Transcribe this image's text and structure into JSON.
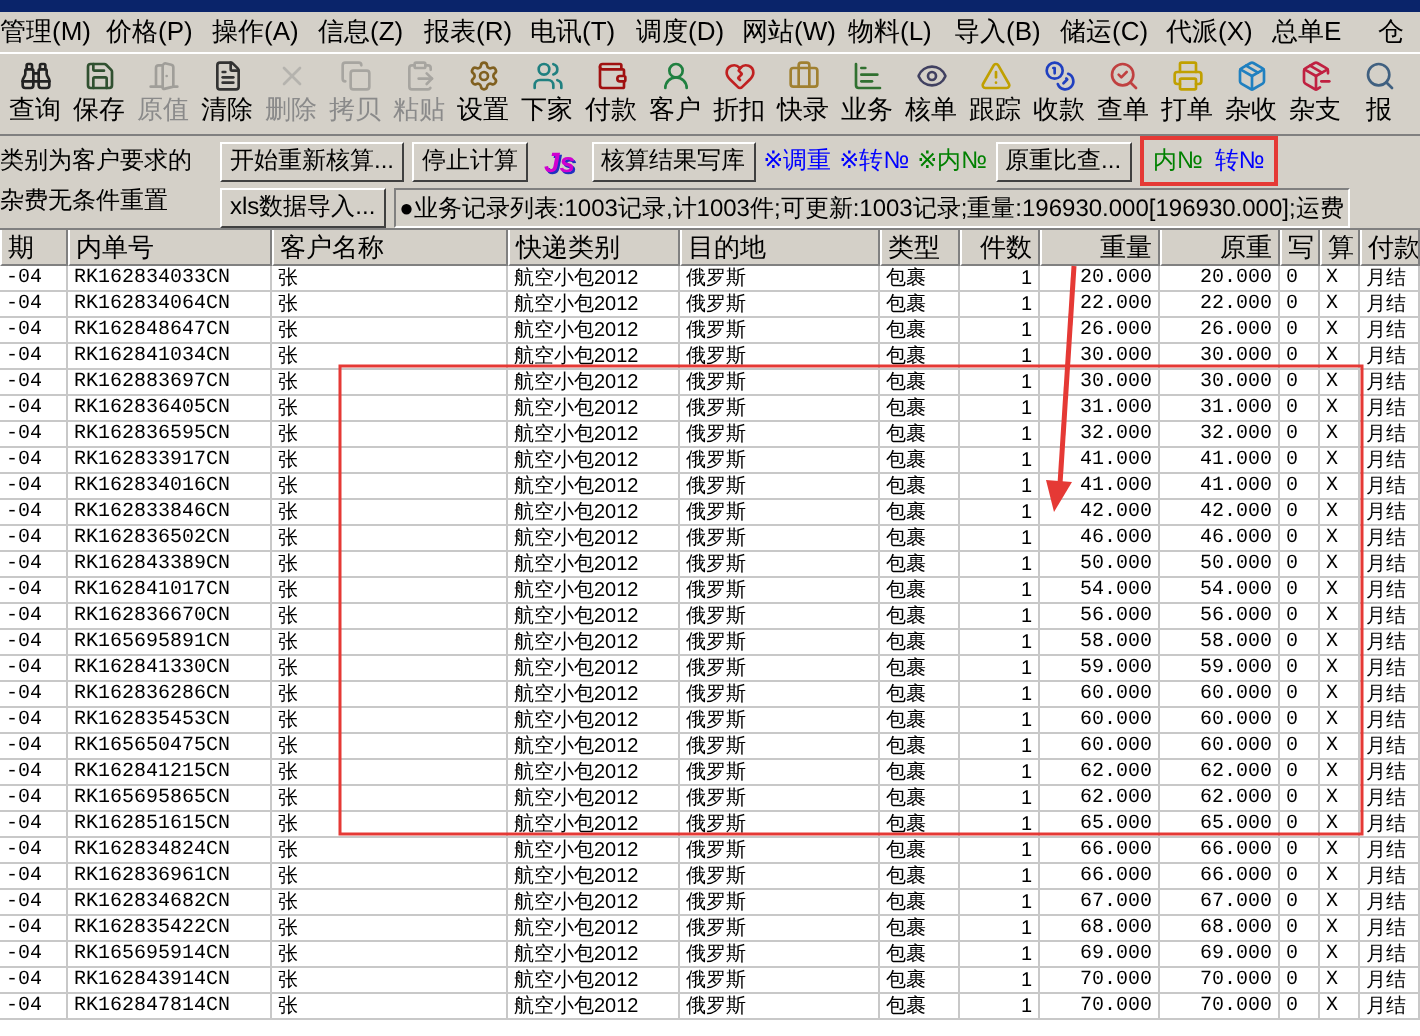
{
  "menu": [
    "管理(M)",
    "价格(P)",
    "操作(A)",
    "信息(Z)",
    "报表(R)",
    "电讯(T)",
    "调度(D)",
    "网站(W)",
    "物料(L)",
    "导入(B)",
    "储运(C)",
    "代派(X)",
    "总单E",
    "仓"
  ],
  "toolbar": [
    {
      "label": "查询",
      "disabled": false
    },
    {
      "label": "保存",
      "disabled": false
    },
    {
      "label": "原值",
      "disabled": true
    },
    {
      "label": "清除",
      "disabled": false
    },
    {
      "label": "删除",
      "disabled": true
    },
    {
      "label": "拷贝",
      "disabled": true
    },
    {
      "label": "粘贴",
      "disabled": true
    },
    {
      "label": "设置",
      "disabled": false
    },
    {
      "label": "下家",
      "disabled": false
    },
    {
      "label": "付款",
      "disabled": false
    },
    {
      "label": "客户",
      "disabled": false
    },
    {
      "label": "折扣",
      "disabled": false
    },
    {
      "label": "快录",
      "disabled": false
    },
    {
      "label": "业务",
      "disabled": false
    },
    {
      "label": "核单",
      "disabled": false
    },
    {
      "label": "跟踪",
      "disabled": false
    },
    {
      "label": "收款",
      "disabled": false
    },
    {
      "label": "查单",
      "disabled": false
    },
    {
      "label": "打单",
      "disabled": false
    },
    {
      "label": "杂收",
      "disabled": false
    },
    {
      "label": "杂支",
      "disabled": false
    },
    {
      "label": "报",
      "disabled": false
    }
  ],
  "options_note": [
    "类别为客户要求的",
    "杂费无条件重置"
  ],
  "buttons_row1": [
    "开始重新核算...",
    "停止计算"
  ],
  "js_badge": "Js",
  "write_button": "核算结果写库",
  "links": [
    {
      "label": "※调重",
      "color": "#0000ff"
    },
    {
      "label": "※转№",
      "color": "#0000ff"
    },
    {
      "label": "※内№",
      "color": "#008000"
    }
  ],
  "compare_button": "原重比查...",
  "highlight_links": [
    {
      "label": "内№",
      "color": "#008000"
    },
    {
      "label": "转№",
      "color": "#0000ff"
    }
  ],
  "import_button": "xls数据导入...",
  "status": "●业务记录列表:1003记录,计1003件;可更新:1003记录;重量:196930.000[196930.000];运费",
  "table": {
    "columns": [
      "期",
      "内单号",
      "客户名称",
      "快递类别",
      "目的地",
      "类型",
      "件数",
      "重量",
      "原重",
      "写",
      "算",
      "付款"
    ],
    "rows": [
      [
        "-04",
        "RK162834033CN",
        "张",
        "航空小包2012",
        "俄罗斯",
        "包裹",
        "1",
        "20.000",
        "20.000",
        "0",
        "X",
        "月结"
      ],
      [
        "-04",
        "RK162834064CN",
        "张",
        "航空小包2012",
        "俄罗斯",
        "包裹",
        "1",
        "22.000",
        "22.000",
        "0",
        "X",
        "月结"
      ],
      [
        "-04",
        "RK162848647CN",
        "张",
        "航空小包2012",
        "俄罗斯",
        "包裹",
        "1",
        "26.000",
        "26.000",
        "0",
        "X",
        "月结"
      ],
      [
        "-04",
        "RK162841034CN",
        "张",
        "航空小包2012",
        "俄罗斯",
        "包裹",
        "1",
        "30.000",
        "30.000",
        "0",
        "X",
        "月结"
      ],
      [
        "-04",
        "RK162883697CN",
        "张",
        "航空小包2012",
        "俄罗斯",
        "包裹",
        "1",
        "30.000",
        "30.000",
        "0",
        "X",
        "月结"
      ],
      [
        "-04",
        "RK162836405CN",
        "张",
        "航空小包2012",
        "俄罗斯",
        "包裹",
        "1",
        "31.000",
        "31.000",
        "0",
        "X",
        "月结"
      ],
      [
        "-04",
        "RK162836595CN",
        "张",
        "航空小包2012",
        "俄罗斯",
        "包裹",
        "1",
        "32.000",
        "32.000",
        "0",
        "X",
        "月结"
      ],
      [
        "-04",
        "RK162833917CN",
        "张",
        "航空小包2012",
        "俄罗斯",
        "包裹",
        "1",
        "41.000",
        "41.000",
        "0",
        "X",
        "月结"
      ],
      [
        "-04",
        "RK162834016CN",
        "张",
        "航空小包2012",
        "俄罗斯",
        "包裹",
        "1",
        "41.000",
        "41.000",
        "0",
        "X",
        "月结"
      ],
      [
        "-04",
        "RK162833846CN",
        "张",
        "航空小包2012",
        "俄罗斯",
        "包裹",
        "1",
        "42.000",
        "42.000",
        "0",
        "X",
        "月结"
      ],
      [
        "-04",
        "RK162836502CN",
        "张",
        "航空小包2012",
        "俄罗斯",
        "包裹",
        "1",
        "46.000",
        "46.000",
        "0",
        "X",
        "月结"
      ],
      [
        "-04",
        "RK162843389CN",
        "张",
        "航空小包2012",
        "俄罗斯",
        "包裹",
        "1",
        "50.000",
        "50.000",
        "0",
        "X",
        "月结"
      ],
      [
        "-04",
        "RK162841017CN",
        "张",
        "航空小包2012",
        "俄罗斯",
        "包裹",
        "1",
        "54.000",
        "54.000",
        "0",
        "X",
        "月结"
      ],
      [
        "-04",
        "RK162836670CN",
        "张",
        "航空小包2012",
        "俄罗斯",
        "包裹",
        "1",
        "56.000",
        "56.000",
        "0",
        "X",
        "月结"
      ],
      [
        "-04",
        "RK165695891CN",
        "张",
        "航空小包2012",
        "俄罗斯",
        "包裹",
        "1",
        "58.000",
        "58.000",
        "0",
        "X",
        "月结"
      ],
      [
        "-04",
        "RK162841330CN",
        "张",
        "航空小包2012",
        "俄罗斯",
        "包裹",
        "1",
        "59.000",
        "59.000",
        "0",
        "X",
        "月结"
      ],
      [
        "-04",
        "RK162836286CN",
        "张",
        "航空小包2012",
        "俄罗斯",
        "包裹",
        "1",
        "60.000",
        "60.000",
        "0",
        "X",
        "月结"
      ],
      [
        "-04",
        "RK162835453CN",
        "张",
        "航空小包2012",
        "俄罗斯",
        "包裹",
        "1",
        "60.000",
        "60.000",
        "0",
        "X",
        "月结"
      ],
      [
        "-04",
        "RK165650475CN",
        "张",
        "航空小包2012",
        "俄罗斯",
        "包裹",
        "1",
        "60.000",
        "60.000",
        "0",
        "X",
        "月结"
      ],
      [
        "-04",
        "RK162841215CN",
        "张",
        "航空小包2012",
        "俄罗斯",
        "包裹",
        "1",
        "62.000",
        "62.000",
        "0",
        "X",
        "月结"
      ],
      [
        "-04",
        "RK165695865CN",
        "张",
        "航空小包2012",
        "俄罗斯",
        "包裹",
        "1",
        "62.000",
        "62.000",
        "0",
        "X",
        "月结"
      ],
      [
        "-04",
        "RK162851615CN",
        "张",
        "航空小包2012",
        "俄罗斯",
        "包裹",
        "1",
        "65.000",
        "65.000",
        "0",
        "X",
        "月结"
      ],
      [
        "-04",
        "RK162834824CN",
        "张",
        "航空小包2012",
        "俄罗斯",
        "包裹",
        "1",
        "66.000",
        "66.000",
        "0",
        "X",
        "月结"
      ],
      [
        "-04",
        "RK162836961CN",
        "张",
        "航空小包2012",
        "俄罗斯",
        "包裹",
        "1",
        "66.000",
        "66.000",
        "0",
        "X",
        "月结"
      ],
      [
        "-04",
        "RK162834682CN",
        "张",
        "航空小包2012",
        "俄罗斯",
        "包裹",
        "1",
        "67.000",
        "67.000",
        "0",
        "X",
        "月结"
      ],
      [
        "-04",
        "RK162835422CN",
        "张",
        "航空小包2012",
        "俄罗斯",
        "包裹",
        "1",
        "68.000",
        "68.000",
        "0",
        "X",
        "月结"
      ],
      [
        "-04",
        "RK165695914CN",
        "张",
        "航空小包2012",
        "俄罗斯",
        "包裹",
        "1",
        "69.000",
        "69.000",
        "0",
        "X",
        "月结"
      ],
      [
        "-04",
        "RK162843914CN",
        "张",
        "航空小包2012",
        "俄罗斯",
        "包裹",
        "1",
        "70.000",
        "70.000",
        "0",
        "X",
        "月结"
      ],
      [
        "-04",
        "RK162847814CN",
        "张",
        "航空小包2012",
        "俄罗斯",
        "包裹",
        "1",
        "70.000",
        "70.000",
        "0",
        "X",
        "月结"
      ]
    ]
  }
}
